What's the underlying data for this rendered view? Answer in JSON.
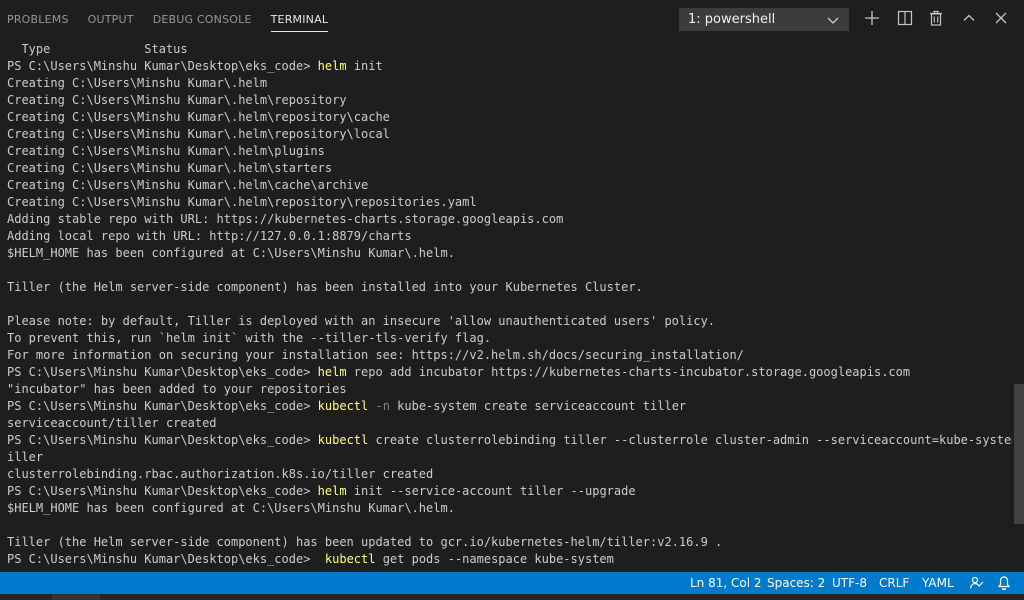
{
  "panel": {
    "tabs": [
      {
        "label": "PROBLEMS",
        "active": false
      },
      {
        "label": "OUTPUT",
        "active": false
      },
      {
        "label": "DEBUG CONSOLE",
        "active": false
      },
      {
        "label": "TERMINAL",
        "active": true
      }
    ],
    "terminal_select": "1: powershell",
    "icons": [
      "add-icon",
      "split-icon",
      "trash-icon",
      "chevron-up-icon",
      "close-icon"
    ]
  },
  "terminal": {
    "lines": [
      [
        {
          "t": "  Type             Status"
        }
      ],
      [
        {
          "t": "PS C:\\Users\\Minshu Kumar\\Desktop\\eks_code> "
        },
        {
          "t": "helm",
          "c": "cmd"
        },
        {
          "t": " init"
        }
      ],
      [
        {
          "t": "Creating C:\\Users\\Minshu Kumar\\.helm"
        }
      ],
      [
        {
          "t": "Creating C:\\Users\\Minshu Kumar\\.helm\\repository"
        }
      ],
      [
        {
          "t": "Creating C:\\Users\\Minshu Kumar\\.helm\\repository\\cache"
        }
      ],
      [
        {
          "t": "Creating C:\\Users\\Minshu Kumar\\.helm\\repository\\local"
        }
      ],
      [
        {
          "t": "Creating C:\\Users\\Minshu Kumar\\.helm\\plugins"
        }
      ],
      [
        {
          "t": "Creating C:\\Users\\Minshu Kumar\\.helm\\starters"
        }
      ],
      [
        {
          "t": "Creating C:\\Users\\Minshu Kumar\\.helm\\cache\\archive"
        }
      ],
      [
        {
          "t": "Creating C:\\Users\\Minshu Kumar\\.helm\\repository\\repositories.yaml"
        }
      ],
      [
        {
          "t": "Adding stable repo with URL: https://kubernetes-charts.storage.googleapis.com"
        }
      ],
      [
        {
          "t": "Adding local repo with URL: http://127.0.0.1:8879/charts"
        }
      ],
      [
        {
          "t": "$HELM_HOME has been configured at C:\\Users\\Minshu Kumar\\.helm."
        }
      ],
      [
        {
          "t": ""
        }
      ],
      [
        {
          "t": "Tiller (the Helm server-side component) has been installed into your Kubernetes Cluster."
        }
      ],
      [
        {
          "t": ""
        }
      ],
      [
        {
          "t": "Please note: by default, Tiller is deployed with an insecure 'allow unauthenticated users' policy."
        }
      ],
      [
        {
          "t": "To prevent this, run `helm init` with the --tiller-tls-verify flag."
        }
      ],
      [
        {
          "t": "For more information on securing your installation see: https://v2.helm.sh/docs/securing_installation/"
        }
      ],
      [
        {
          "t": "PS C:\\Users\\Minshu Kumar\\Desktop\\eks_code> "
        },
        {
          "t": "helm",
          "c": "cmd"
        },
        {
          "t": " repo add incubator https://kubernetes-charts-incubator.storage.googleapis.com"
        }
      ],
      [
        {
          "t": "\"incubator\" has been added to your repositories"
        }
      ],
      [
        {
          "t": "PS C:\\Users\\Minshu Kumar\\Desktop\\eks_code> "
        },
        {
          "t": "kubectl",
          "c": "cmd"
        },
        {
          "t": " "
        },
        {
          "t": "-n",
          "c": "flag"
        },
        {
          "t": " kube-system create serviceaccount tiller"
        }
      ],
      [
        {
          "t": "serviceaccount/tiller created"
        }
      ],
      [
        {
          "t": "PS C:\\Users\\Minshu Kumar\\Desktop\\eks_code> "
        },
        {
          "t": "kubectl",
          "c": "cmd"
        },
        {
          "t": " create clusterrolebinding tiller --clusterrole cluster-admin --serviceaccount=kube-system:t"
        }
      ],
      [
        {
          "t": "iller"
        }
      ],
      [
        {
          "t": "clusterrolebinding.rbac.authorization.k8s.io/tiller created"
        }
      ],
      [
        {
          "t": "PS C:\\Users\\Minshu Kumar\\Desktop\\eks_code> "
        },
        {
          "t": "helm",
          "c": "cmd"
        },
        {
          "t": " init --service-account tiller --upgrade"
        }
      ],
      [
        {
          "t": "$HELM_HOME has been configured at C:\\Users\\Minshu Kumar\\.helm."
        }
      ],
      [
        {
          "t": ""
        }
      ],
      [
        {
          "t": "Tiller (the Helm server-side component) has been updated to gcr.io/kubernetes-helm/tiller:v2.16.9 ."
        }
      ],
      [
        {
          "t": "PS C:\\Users\\Minshu Kumar\\Desktop\\eks_code>  "
        },
        {
          "t": "kubectl",
          "c": "cmd"
        },
        {
          "t": " get pods --namespace kube-system"
        }
      ]
    ]
  },
  "statusbar": {
    "position": "Ln 81, Col 2",
    "spaces": "Spaces: 2",
    "encoding": "UTF-8",
    "eol": "CRLF",
    "language": "YAML"
  },
  "colors": {
    "background": "#1e1e1e",
    "statusbar": "#007acc",
    "command": "#ffff7f",
    "flag": "#808080",
    "text": "#cccccc"
  }
}
